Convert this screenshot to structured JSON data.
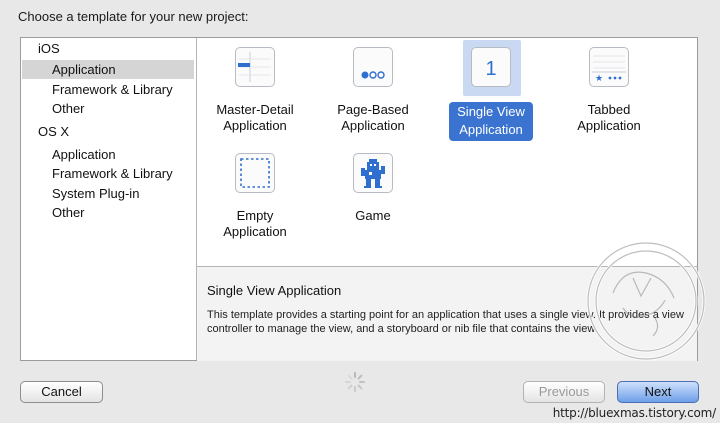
{
  "dialog": {
    "title": "Choose a template for your new project:"
  },
  "sidebar": {
    "groups": [
      {
        "label": "iOS",
        "items": [
          "Application",
          "Framework & Library",
          "Other"
        ],
        "selected": "Application"
      },
      {
        "label": "OS X",
        "items": [
          "Application",
          "Framework & Library",
          "System Plug-in",
          "Other"
        ]
      }
    ]
  },
  "templates": [
    {
      "label_line1": "Master-Detail",
      "label_line2": "Application",
      "icon": "master-detail-icon"
    },
    {
      "label_line1": "Page-Based",
      "label_line2": "Application",
      "icon": "page-based-icon"
    },
    {
      "label_line1": "Single View",
      "label_line2": "Application",
      "icon": "single-view-icon",
      "icon_glyph": "1",
      "selected": true
    },
    {
      "label_line1": "Tabbed",
      "label_line2": "Application",
      "icon": "tabbed-icon"
    },
    {
      "label_line1": "Empty",
      "label_line2": "Application",
      "icon": "empty-icon"
    },
    {
      "label_line1": "Game",
      "label_line2": "",
      "icon": "game-icon"
    }
  ],
  "description": {
    "title": "Single View Application",
    "text": "This template provides a starting point for an application that uses a single view. It provides a view controller to manage the view, and a storyboard or nib file that contains the view."
  },
  "buttons": {
    "cancel": "Cancel",
    "previous": "Previous",
    "next": "Next"
  },
  "footer": {
    "url": "http://bluexmas.tistory.com/"
  },
  "colors": {
    "selection_blue": "#3b73d1",
    "icon_blue": "#2f6fd0",
    "sidebar_selection": "#d5d5d5"
  }
}
